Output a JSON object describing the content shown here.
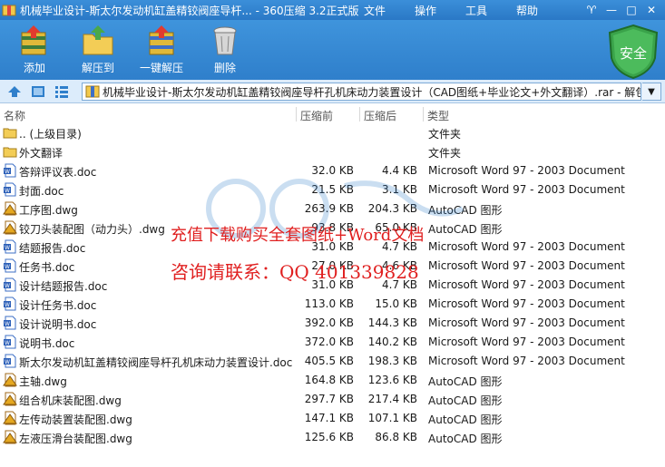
{
  "window": {
    "title": "机械毕业设计-斯太尔发动机缸盖精铰阀座导杆...  -  360压缩 3.2正式版",
    "menu": [
      "文件",
      "操作",
      "工具",
      "帮助"
    ],
    "controls": [
      "♈",
      "—",
      "□",
      "✕"
    ]
  },
  "toolbar": {
    "add_label": "添加",
    "extract_label": "解压到",
    "one_click_label": "一键解压",
    "delete_label": "删除",
    "security_label": "安全"
  },
  "address": {
    "path": "机械毕业设计-斯太尔发动机缸盖精铰阀座导杆孔机床动力装置设计（CAD图纸+毕业论文+外文翻译）.rar - 解包"
  },
  "columns": {
    "name": "名称",
    "compressed": "压缩前",
    "original": "压缩后",
    "type": "类型"
  },
  "files": [
    {
      "name": ".. (上级目录)",
      "size": "",
      "packed": "",
      "type": "文件夹",
      "icon": "folder-up-icon"
    },
    {
      "name": "外文翻译",
      "size": "",
      "packed": "",
      "type": "文件夹",
      "icon": "folder-icon"
    },
    {
      "name": "答辩评议表.doc",
      "size": "32.0 KB",
      "packed": "4.4 KB",
      "type": "Microsoft Word 97 - 2003 Document",
      "icon": "word-doc-icon"
    },
    {
      "name": "封面.doc",
      "size": "21.5 KB",
      "packed": "3.1 KB",
      "type": "Microsoft Word 97 - 2003 Document",
      "icon": "word-doc-icon"
    },
    {
      "name": "工序图.dwg",
      "size": "263.9 KB",
      "packed": "204.3 KB",
      "type": "AutoCAD 图形",
      "icon": "dwg-icon"
    },
    {
      "name": "铰刀头装配图（动力头）.dwg",
      "size": "93.8 KB",
      "packed": "65.0 KB",
      "type": "AutoCAD 图形",
      "icon": "dwg-icon"
    },
    {
      "name": "结题报告.doc",
      "size": "31.0 KB",
      "packed": "4.7 KB",
      "type": "Microsoft Word 97 - 2003 Document",
      "icon": "word-doc-icon"
    },
    {
      "name": "任务书.doc",
      "size": "27.0 KB",
      "packed": "4.6 KB",
      "type": "Microsoft Word 97 - 2003 Document",
      "icon": "word-doc-icon"
    },
    {
      "name": "设计结题报告.doc",
      "size": "31.0 KB",
      "packed": "4.7 KB",
      "type": "Microsoft Word 97 - 2003 Document",
      "icon": "word-doc-icon"
    },
    {
      "name": "设计任务书.doc",
      "size": "113.0 KB",
      "packed": "15.0 KB",
      "type": "Microsoft Word 97 - 2003 Document",
      "icon": "word-doc-icon"
    },
    {
      "name": "设计说明书.doc",
      "size": "392.0 KB",
      "packed": "144.3 KB",
      "type": "Microsoft Word 97 - 2003 Document",
      "icon": "word-doc-icon"
    },
    {
      "name": "说明书.doc",
      "size": "372.0 KB",
      "packed": "140.2 KB",
      "type": "Microsoft Word 97 - 2003 Document",
      "icon": "word-doc-icon"
    },
    {
      "name": "斯太尔发动机缸盖精铰阀座导杆孔机床动力装置设计.doc",
      "size": "405.5 KB",
      "packed": "198.3 KB",
      "type": "Microsoft Word 97 - 2003 Document",
      "icon": "word-doc-icon"
    },
    {
      "name": "主轴.dwg",
      "size": "164.8 KB",
      "packed": "123.6 KB",
      "type": "AutoCAD 图形",
      "icon": "dwg-icon"
    },
    {
      "name": "组合机床装配图.dwg",
      "size": "297.7 KB",
      "packed": "217.4 KB",
      "type": "AutoCAD 图形",
      "icon": "dwg-icon"
    },
    {
      "name": "左传动装置装配图.dwg",
      "size": "147.1 KB",
      "packed": "107.1 KB",
      "type": "AutoCAD 图形",
      "icon": "dwg-icon"
    },
    {
      "name": "左液压滑台装配图.dwg",
      "size": "125.6 KB",
      "packed": "86.8 KB",
      "type": "AutoCAD 图形",
      "icon": "dwg-icon"
    }
  ],
  "overlay": {
    "line1": "充值下载购买全套图纸+Word文档",
    "line2": "咨询请联系：QQ 401339828"
  },
  "colors": {
    "titlebar": "#2a78c6",
    "promo": "#e02020",
    "shield": "#3aa34a"
  }
}
